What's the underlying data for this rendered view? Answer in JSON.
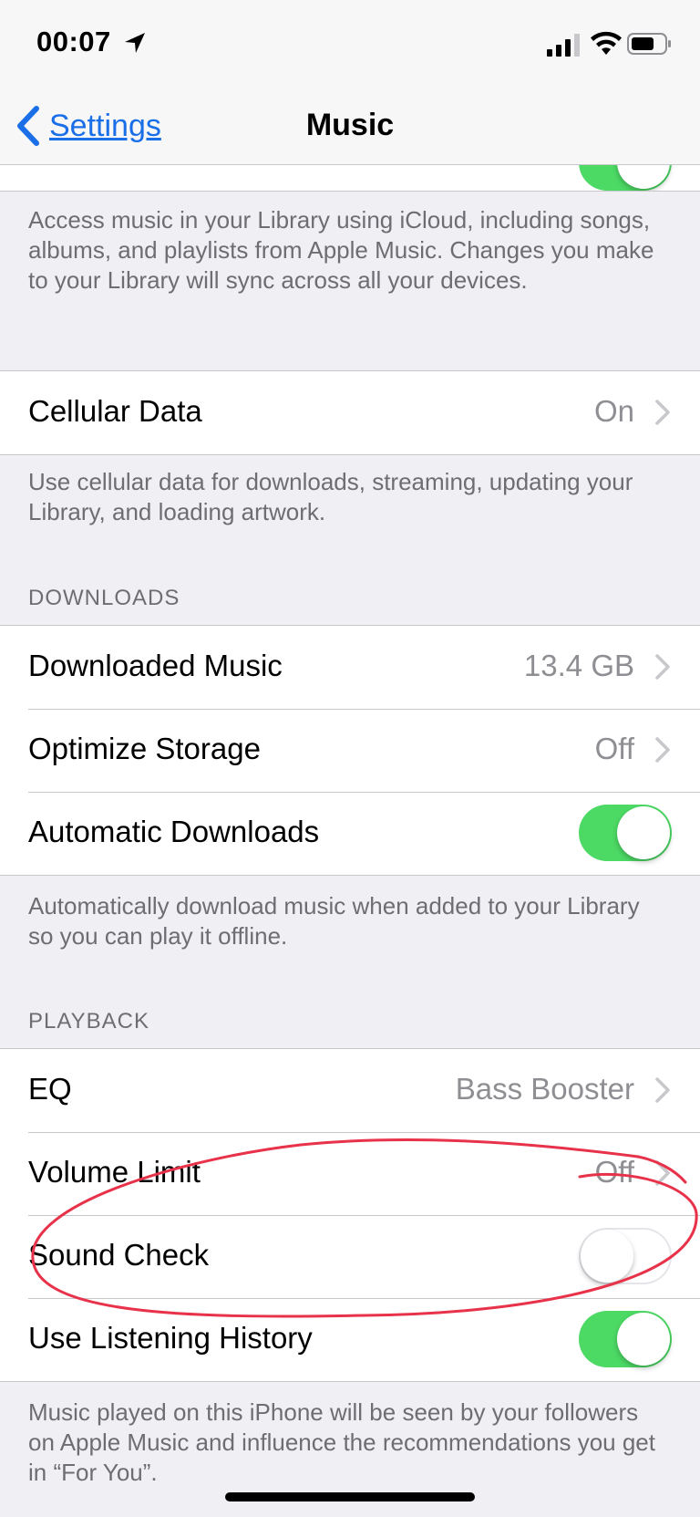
{
  "status_bar": {
    "time": "00:07"
  },
  "nav": {
    "back_label": "Settings",
    "title": "Music"
  },
  "sync_library": {
    "toggle_on": true,
    "footnote": "Access music in your Library using iCloud, including songs, albums, and playlists from Apple Music. Changes you make to your Library will sync across all your devices."
  },
  "cellular": {
    "label": "Cellular Data",
    "value": "On",
    "footnote": "Use cellular data for downloads, streaming, updating your Library, and loading artwork."
  },
  "downloads": {
    "header": "DOWNLOADS",
    "downloaded_music": {
      "label": "Downloaded Music",
      "value": "13.4 GB"
    },
    "optimize_storage": {
      "label": "Optimize Storage",
      "value": "Off"
    },
    "automatic_downloads": {
      "label": "Automatic Downloads",
      "on": true
    },
    "footnote": "Automatically download music when added to your Library so you can play it offline."
  },
  "playback": {
    "header": "PLAYBACK",
    "eq": {
      "label": "EQ",
      "value": "Bass Booster"
    },
    "volume_limit": {
      "label": "Volume Limit",
      "value": "Off"
    },
    "sound_check": {
      "label": "Sound Check",
      "on": false
    },
    "listening_history": {
      "label": "Use Listening History",
      "on": true
    },
    "footnote": "Music played on this iPhone will be seen by your followers on Apple Music and influence the recommendations you get in “For You”."
  },
  "colors": {
    "accent": "#1a6fe8",
    "toggle_on": "#4cd964",
    "annotation": "#e8324a",
    "background": "#efeff4"
  }
}
